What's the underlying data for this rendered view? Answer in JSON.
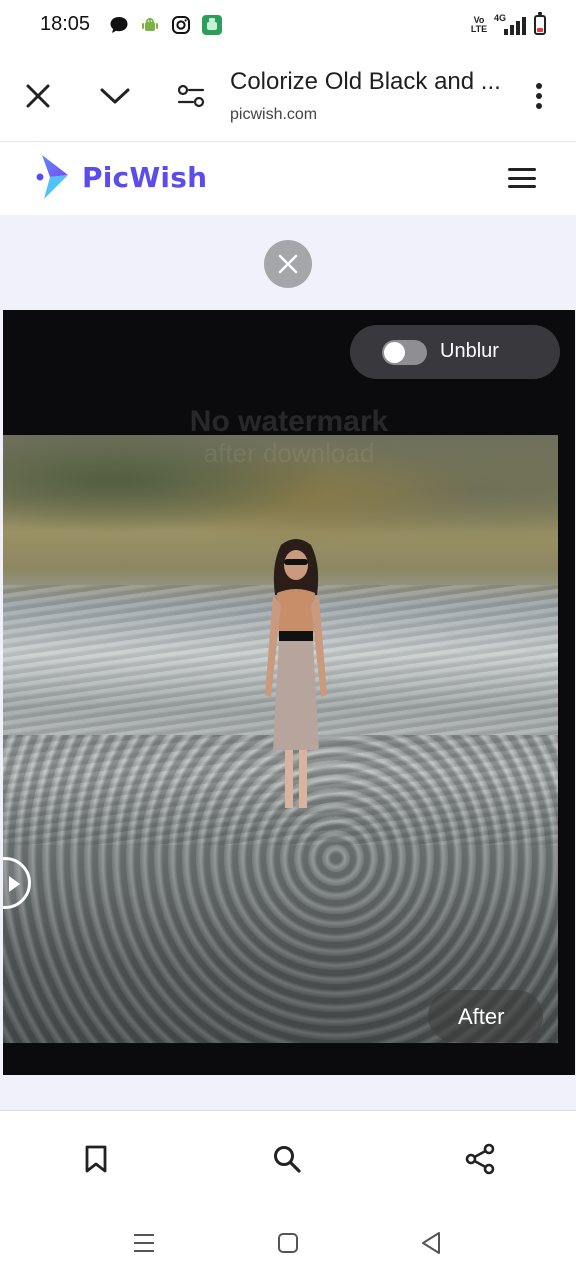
{
  "status_bar": {
    "time": "18:05",
    "left_icons": [
      "message-bubble-icon",
      "android-debug-icon",
      "instagram-icon",
      "app-notification-icon"
    ],
    "volte": "Vo LTE",
    "network": "4G",
    "signal_level": 4,
    "battery_level": 0.15
  },
  "browser": {
    "page_title": "Colorize Old Black and ...",
    "url": "picwish.com",
    "icons": [
      "close-icon",
      "chevron-down-icon",
      "site-settings-icon",
      "more-vert-icon"
    ]
  },
  "site": {
    "brand": "PicWish",
    "brand_color": "#5b4cf0",
    "menu_icon": "hamburger-menu-icon"
  },
  "viewer": {
    "unblur_label": "Unblur",
    "unblur_on": false,
    "watermark_line1": "No watermark",
    "watermark_line2": "after download",
    "after_label": "After"
  },
  "bottom_bar": {
    "icons": [
      "bookmark-icon",
      "search-icon",
      "share-icon"
    ]
  },
  "nav_bar": {
    "icons": [
      "recents-icon",
      "home-icon",
      "back-icon"
    ]
  }
}
